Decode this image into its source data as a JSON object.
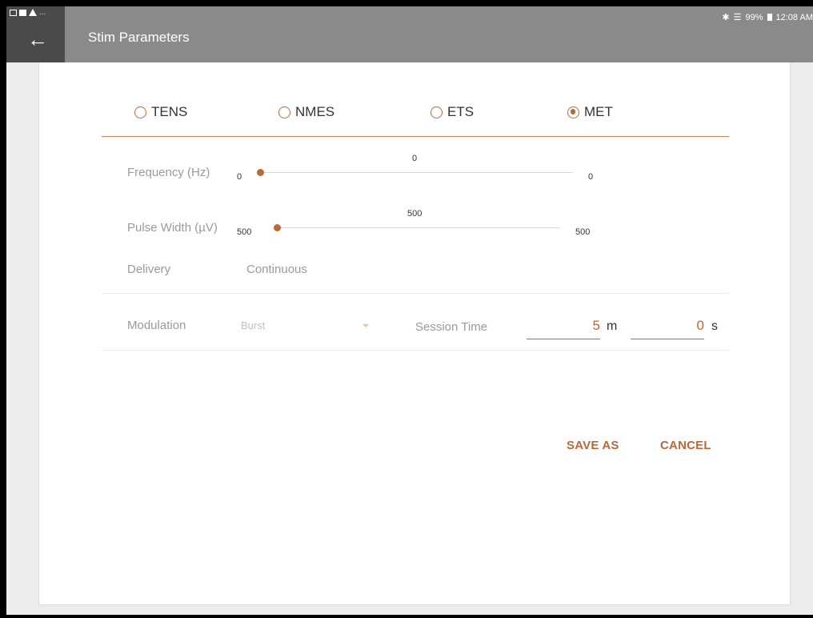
{
  "status_bar": {
    "battery": "99%",
    "time": "12:08 AM",
    "left_overflow": "..."
  },
  "header": {
    "title": "Stim Parameters",
    "back_icon": "arrow-left-icon"
  },
  "modes": [
    {
      "label": "TENS",
      "selected": false
    },
    {
      "label": "NMES",
      "selected": false
    },
    {
      "label": "ETS",
      "selected": false
    },
    {
      "label": "MET",
      "selected": true
    }
  ],
  "frequency": {
    "label": "Frequency (Hz)",
    "min": "0",
    "current": "0",
    "max": "0"
  },
  "pulse_width": {
    "label": "Pulse Width (µV)",
    "min": "500",
    "current": "500",
    "max": "500"
  },
  "delivery": {
    "label": "Delivery",
    "value": "Continuous"
  },
  "modulation": {
    "label": "Modulation",
    "value": "Burst"
  },
  "session_time": {
    "label": "Session Time",
    "minutes": "5",
    "minutes_unit": "m",
    "seconds": "0",
    "seconds_unit": "s"
  },
  "actions": {
    "save_as": "SAVE AS",
    "cancel": "CANCEL"
  },
  "colors": {
    "accent": "#b8693a",
    "appbar": "#8a8a8a",
    "nav": "#4a4a4a"
  }
}
